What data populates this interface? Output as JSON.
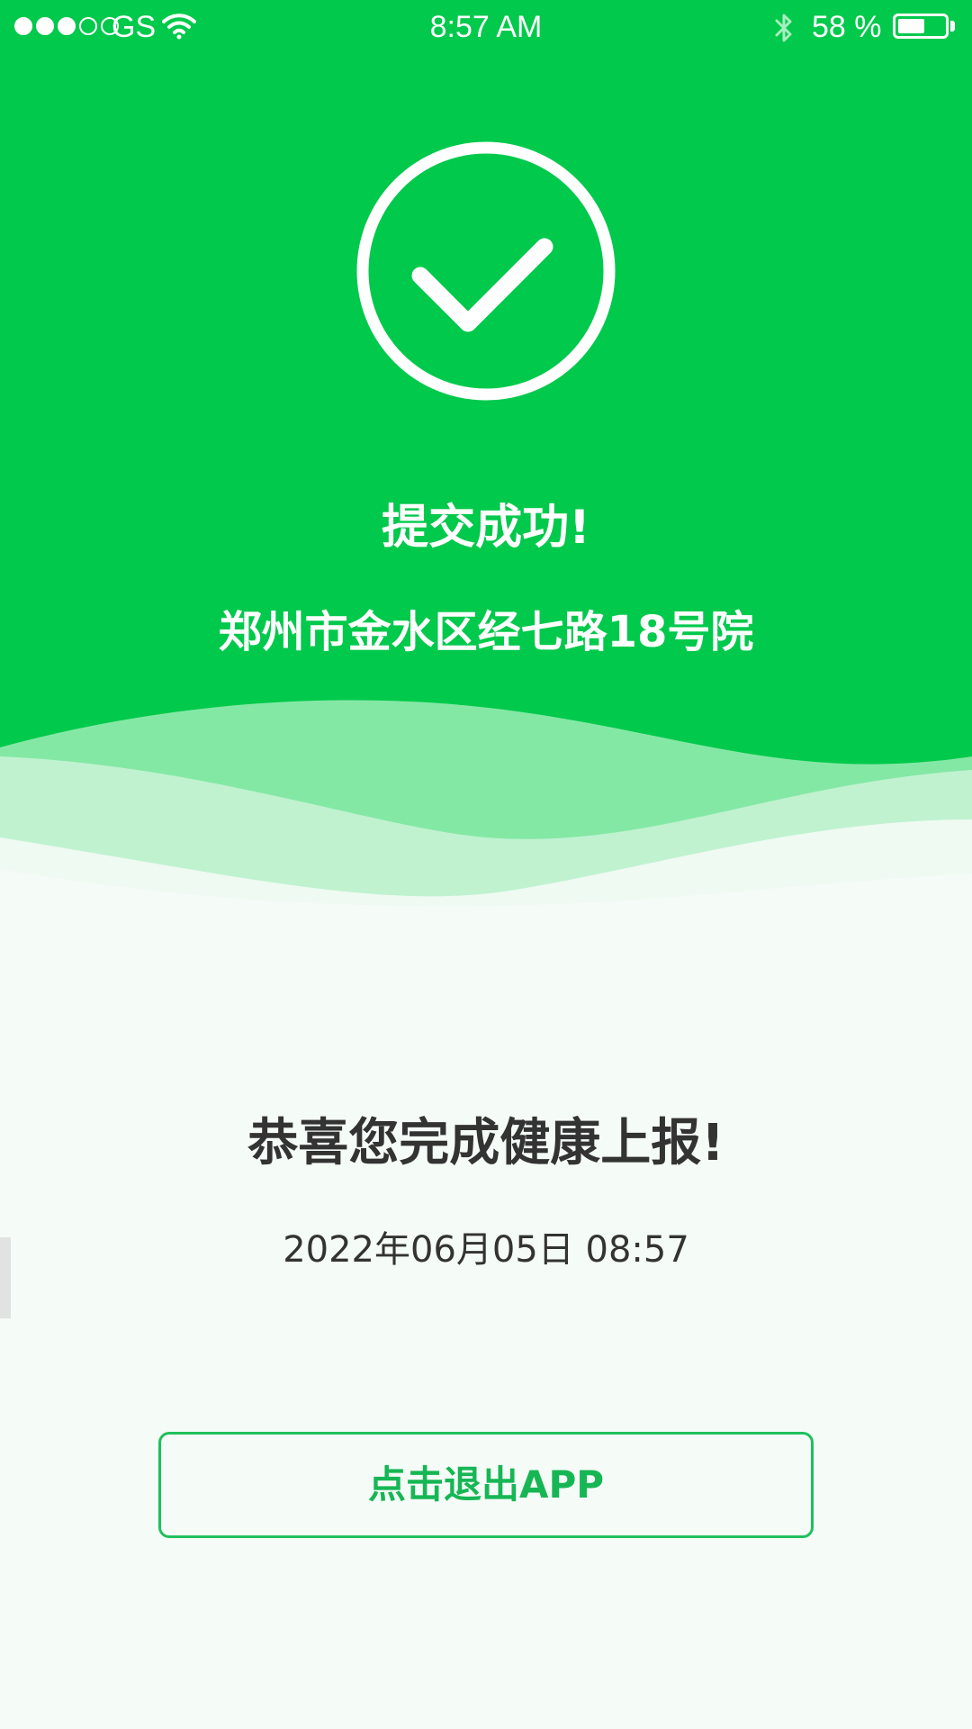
{
  "status_bar": {
    "carrier": "GS",
    "time": "8:57 AM",
    "battery_text": "58 %",
    "battery_level": 0.58,
    "signal_bars": 3
  },
  "success": {
    "title": "提交成功!",
    "address": "郑州市金水区经七路18号院"
  },
  "report": {
    "congrats": "恭喜您完成健康上报!",
    "datetime": "2022年06月05日  08:57"
  },
  "actions": {
    "exit_label": "点击退出APP"
  },
  "colors": {
    "primary": "#00c94b",
    "button": "#17b655",
    "background": "#f5fbf7",
    "text": "#333333"
  },
  "icons": [
    "wifi-icon",
    "bluetooth-icon",
    "battery-icon",
    "check-circle-icon"
  ]
}
